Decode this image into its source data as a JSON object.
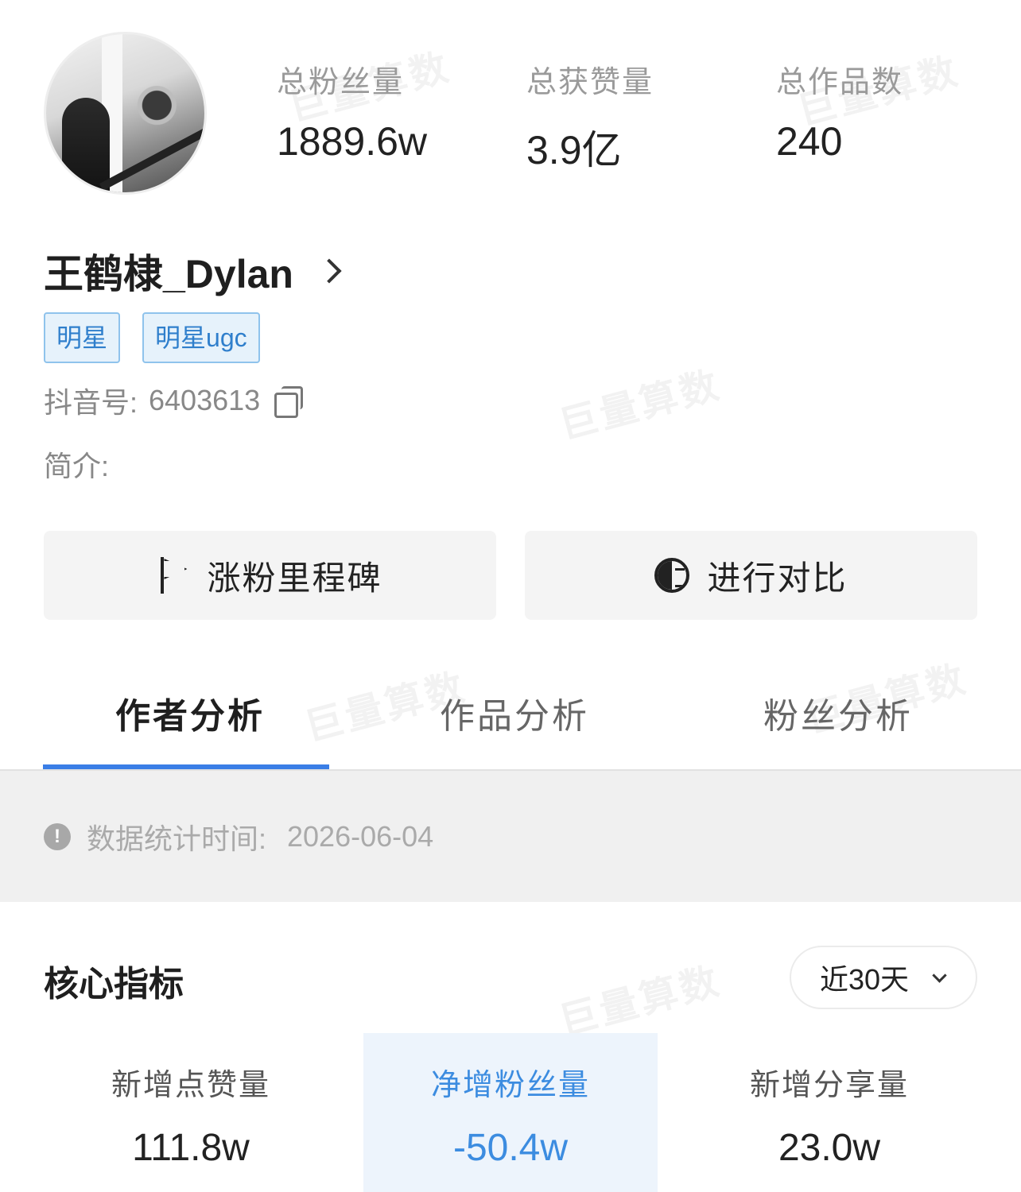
{
  "profile": {
    "name": "王鹤棣_Dylan",
    "tags": [
      "明星",
      "明星ugc"
    ],
    "douyin_id_label": "抖音号:",
    "douyin_id": "6403613",
    "bio_label": "简介:"
  },
  "stats": [
    {
      "label": "总粉丝量",
      "value": "1889.6w"
    },
    {
      "label": "总获赞量",
      "value": "3.9亿"
    },
    {
      "label": "总作品数",
      "value": "240"
    }
  ],
  "actions": {
    "milestone_label": "涨粉里程碑",
    "compare_label": "进行对比"
  },
  "tabs": [
    {
      "label": "作者分析",
      "active": true
    },
    {
      "label": "作品分析",
      "active": false
    },
    {
      "label": "粉丝分析",
      "active": false
    }
  ],
  "notice": {
    "text": "数据统计时间:",
    "date": "2026-06-04"
  },
  "core": {
    "title": "核心指标",
    "range": "近30天",
    "metrics": [
      {
        "label": "新增点赞量",
        "value": "111.8w"
      },
      {
        "label": "净增粉丝量",
        "value": "-50.4w"
      },
      {
        "label": "新增分享量",
        "value": "23.0w"
      }
    ]
  },
  "watermark": "巨量算数",
  "colors": {
    "accent": "#3a7ee6",
    "tag_border": "#8fc3ec",
    "tag_text": "#2f7fcc",
    "highlight_bg": "#edf4fc"
  }
}
